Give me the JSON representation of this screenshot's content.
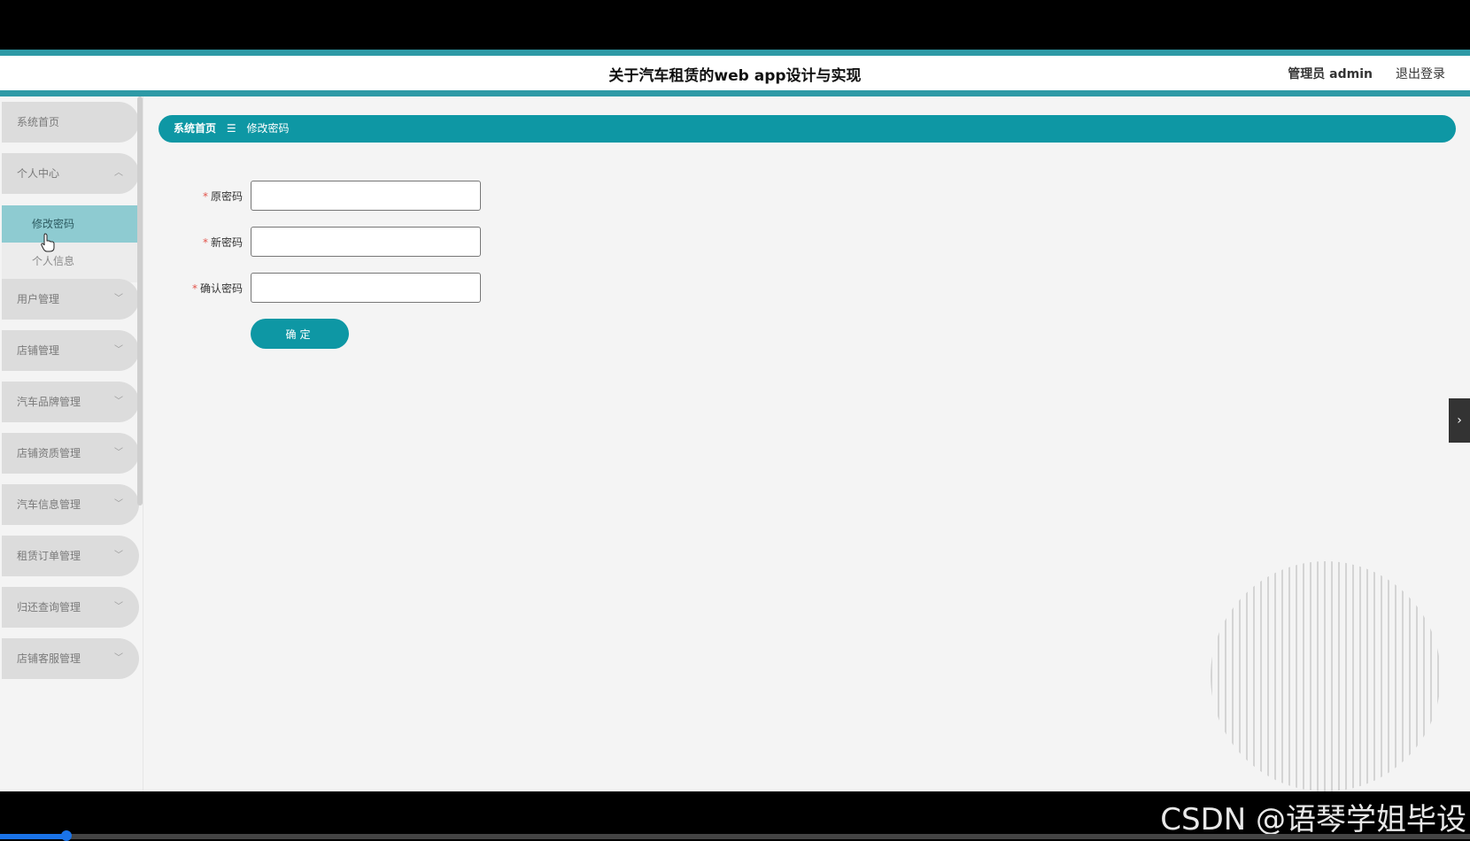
{
  "header": {
    "title": "关于汽车租赁的web app设计与实现",
    "user": "管理员 admin",
    "logout": "退出登录"
  },
  "sidebar": {
    "items": [
      {
        "label": "系统首页"
      },
      {
        "label": "个人中心",
        "expanded": true
      },
      {
        "label": "用户管理"
      },
      {
        "label": "店铺管理"
      },
      {
        "label": "汽车品牌管理"
      },
      {
        "label": "店铺资质管理"
      },
      {
        "label": "汽车信息管理"
      },
      {
        "label": "租赁订单管理"
      },
      {
        "label": "归还查询管理"
      },
      {
        "label": "店铺客服管理"
      }
    ],
    "submenu": [
      {
        "label": "修改密码",
        "active": true
      },
      {
        "label": "个人信息"
      }
    ]
  },
  "breadcrumb": {
    "home": "系统首页",
    "separator": "☰",
    "current": "修改密码"
  },
  "form": {
    "required_mark": "*",
    "fields": [
      {
        "label": "原密码",
        "value": ""
      },
      {
        "label": "新密码",
        "value": ""
      },
      {
        "label": "确认密码",
        "value": ""
      }
    ],
    "submit": "确定"
  },
  "watermark": "CSDN @语琴学姐毕设",
  "video_progress": 0.045,
  "colors": {
    "accent": "#0e97a4",
    "header_border": "#2e9aa6",
    "active_submenu": "#8ecbd1",
    "required": "#e2534b"
  }
}
